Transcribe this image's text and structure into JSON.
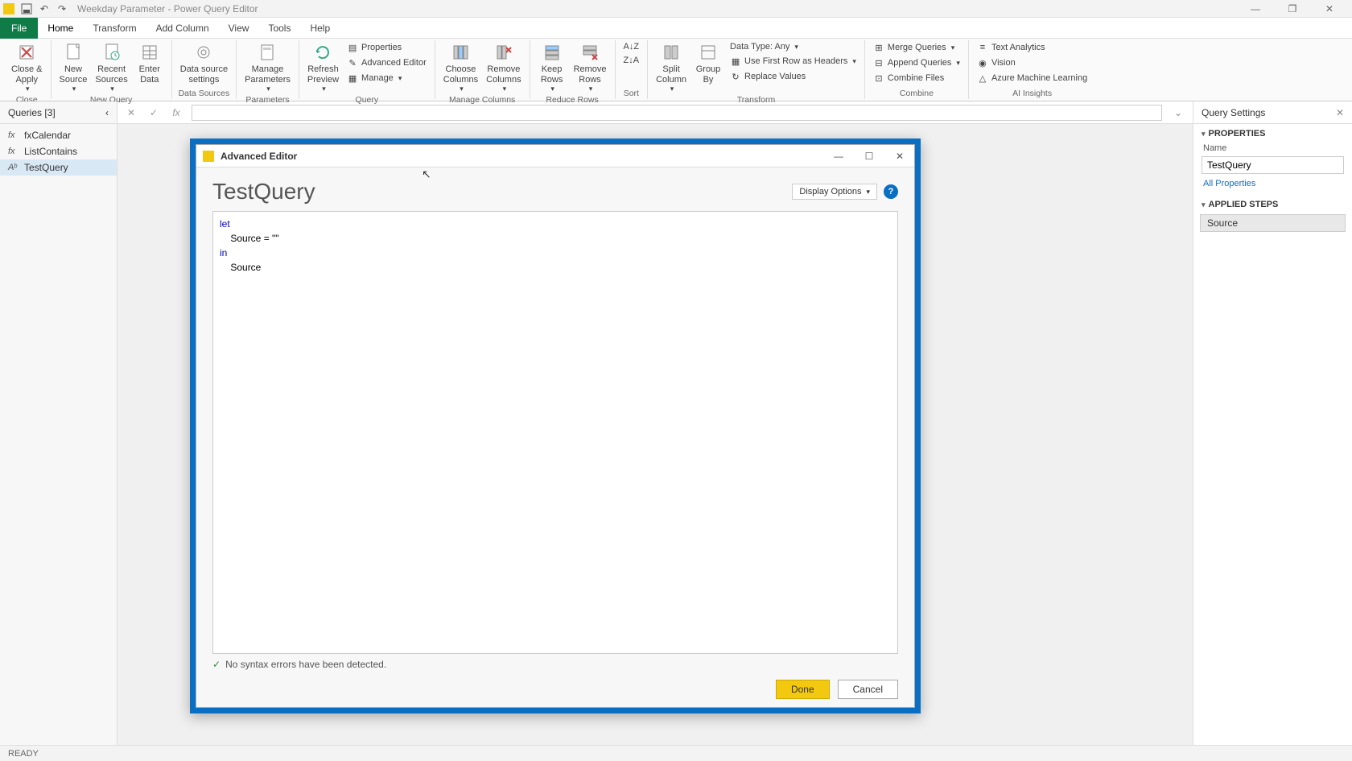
{
  "window": {
    "title": "Weekday Parameter - Power Query Editor",
    "minimize": "—",
    "maximize": "❐",
    "close": "✕"
  },
  "tabs": {
    "file": "File",
    "home": "Home",
    "transform": "Transform",
    "addcolumn": "Add Column",
    "view": "View",
    "tools": "Tools",
    "help": "Help"
  },
  "ribbon": {
    "close_apply": "Close &\nApply",
    "new_source": "New\nSource",
    "recent_sources": "Recent\nSources",
    "enter_data": "Enter\nData",
    "data_source_settings": "Data source\nsettings",
    "manage_parameters": "Manage\nParameters",
    "refresh_preview": "Refresh\nPreview",
    "properties": "Properties",
    "advanced_editor": "Advanced Editor",
    "manage": "Manage",
    "choose_columns": "Choose\nColumns",
    "remove_columns": "Remove\nColumns",
    "keep_rows": "Keep\nRows",
    "remove_rows": "Remove\nRows",
    "sort_asc": "",
    "sort_desc": "",
    "split_column": "Split\nColumn",
    "group_by": "Group\nBy",
    "data_type": "Data Type: Any",
    "first_row_headers": "Use First Row as Headers",
    "replace_values": "Replace Values",
    "merge_queries": "Merge Queries",
    "append_queries": "Append Queries",
    "combine_files": "Combine Files",
    "text_analytics": "Text Analytics",
    "vision": "Vision",
    "azure_ml": "Azure Machine Learning",
    "groups": {
      "close": "Close",
      "new_query": "New Query",
      "data_sources": "Data Sources",
      "parameters": "Parameters",
      "query": "Query",
      "manage_columns": "Manage Columns",
      "reduce_rows": "Reduce Rows",
      "sort": "Sort",
      "transform": "Transform",
      "combine": "Combine",
      "ai_insights": "AI Insights"
    }
  },
  "queries": {
    "header": "Queries [3]",
    "items": [
      {
        "name": "fxCalendar",
        "icon": "fx"
      },
      {
        "name": "ListContains",
        "icon": "fx"
      },
      {
        "name": "TestQuery",
        "icon": "Aᵇ"
      }
    ],
    "collapse": "‹"
  },
  "formula_bar": {
    "cancel": "✕",
    "commit": "✓",
    "fx": "fx",
    "value": "",
    "expand": "⌄"
  },
  "modal": {
    "title": "Advanced Editor",
    "minimize": "—",
    "maximize": "☐",
    "close": "✕",
    "query_name": "TestQuery",
    "display_options": "Display Options",
    "help": "?",
    "code_let": "let",
    "code_source_assign": "    Source = \"\"",
    "code_in": "in",
    "code_source": "    Source",
    "syntax_msg": "No syntax errors have been detected.",
    "check": "✓",
    "done": "Done",
    "cancel": "Cancel"
  },
  "settings": {
    "header": "Query Settings",
    "close": "✕",
    "properties_hdr": "PROPERTIES",
    "name_label": "Name",
    "name_value": "TestQuery",
    "all_properties": "All Properties",
    "applied_steps_hdr": "APPLIED STEPS",
    "step1": "Source"
  },
  "statusbar": {
    "ready": "READY"
  }
}
